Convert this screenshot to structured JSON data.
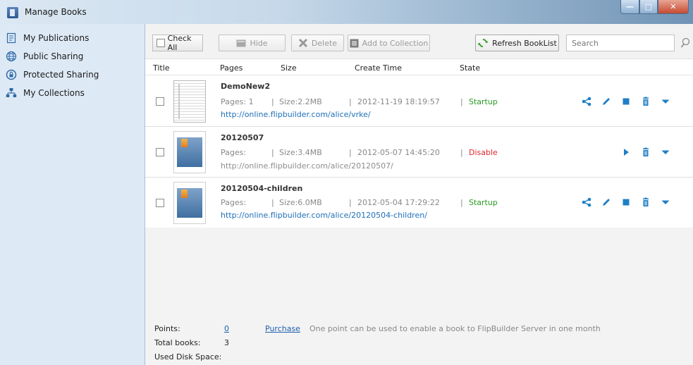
{
  "window": {
    "title": "Manage Books",
    "buttons": {
      "minimize": "—",
      "maximize": "□",
      "close": "✕"
    }
  },
  "sidebar": {
    "items": [
      {
        "label": "My Publications",
        "icon": "document-icon"
      },
      {
        "label": "Public Sharing",
        "icon": "globe-icon"
      },
      {
        "label": "Protected Sharing",
        "icon": "lock-icon"
      },
      {
        "label": "My Collections",
        "icon": "collections-tree-icon"
      }
    ]
  },
  "toolbar": {
    "check_all_label": "Check All",
    "hide_label": "Hide",
    "delete_label": "Delete",
    "add_to_collection_label": "Add to Collection",
    "refresh_label": "Refresh BookList",
    "search_placeholder": "Search"
  },
  "columns": {
    "title": "Title",
    "pages": "Pages",
    "size": "Size",
    "create_time": "Create Time",
    "state": "State"
  },
  "books": [
    {
      "name": "DemoNew2",
      "pages": "Pages: 1",
      "size": "Size:2.2MB",
      "create_time": "2012-11-19 18:19:57",
      "state": "Startup",
      "url": "http://online.flipbuilder.com/alice/vrke/",
      "separator": "|"
    },
    {
      "name": "20120507",
      "pages": "Pages:",
      "size": "Size:3.4MB",
      "create_time": "2012-05-07 14:45:20",
      "state": "Disable",
      "url": "http://online.flipbuilder.com/alice/20120507/",
      "separator": "|"
    },
    {
      "name": "20120504-children",
      "pages": "Pages:",
      "size": "Size:6.0MB",
      "create_time": "2012-05-04 17:29:22",
      "state": "Startup",
      "url": "http://online.flipbuilder.com/alice/20120504-children/",
      "separator": "|"
    }
  ],
  "footer": {
    "points_label": "Points:",
    "points_value": "0",
    "purchase_label": "Purchase",
    "points_note": "One point can be used to enable a book to FlipBuilder Server in one month",
    "total_books_label": "Total books:",
    "total_books_value": "3",
    "disk_space_label": "Used Disk Space:"
  },
  "colors": {
    "accent": "#1f7fc6",
    "startup": "#2a9a23",
    "disable": "#e0262b",
    "link": "#2070b8",
    "sidebar_bg": "#dde9f5"
  }
}
